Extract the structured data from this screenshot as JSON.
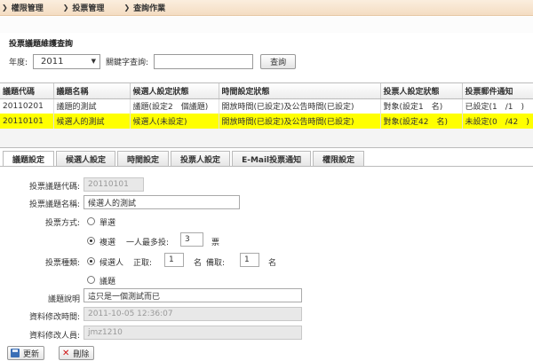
{
  "breadcrumb": [
    "權限管理",
    "投票管理",
    "查詢作業"
  ],
  "search": {
    "title": "投票議題維護查詢",
    "year_label": "年度:",
    "year_value": "2011",
    "keyword_label": "關鍵字查詢:",
    "keyword_value": "",
    "button": "查詢"
  },
  "table": {
    "headers": [
      "議題代碼",
      "議題名稱",
      "候選人設定狀態",
      "時間設定狀態",
      "投票人設定狀態",
      "投票郵件通知"
    ],
    "rows": [
      [
        "20110201",
        "議題的測試",
        "議題(設定2　個議題)",
        "開放時間(已設定)及公告時間(已設定)",
        "對象(設定1　名)",
        "已設定(1　/1　)"
      ],
      [
        "20110101",
        "候選人的測試",
        "候選人(未設定)",
        "開放時間(已設定)及公告時間(已設定)",
        "對象(設定42　名)",
        "未設定(0　/42　)"
      ]
    ]
  },
  "tabs": [
    "議題設定",
    "候選人設定",
    "時間設定",
    "投票人設定",
    "E-Mail投票通知",
    "權限設定"
  ],
  "form": {
    "code_label": "投票議題代碼:",
    "code_value": "20110101",
    "name_label": "投票議題名稱:",
    "name_value": "候選人的測試",
    "method_label": "投票方式:",
    "method_single": "單選",
    "method_multi": "複選",
    "max_label": "一人最多投:",
    "max_value": "3",
    "max_unit": "票",
    "type_label": "投票種類:",
    "type_candidate": "候選人",
    "main_label": "正取:",
    "main_value": "1",
    "unit1": "名",
    "backup_label": "備取:",
    "backup_value": "1",
    "unit2": "名",
    "type_issue": "議題",
    "desc_label": "議題說明",
    "desc_value": "這只是一個測試而已",
    "modtime_label": "資料修改時間:",
    "modtime_value": "2011-10-05 12:36:07",
    "modby_label": "資料修改人員:",
    "modby_value": "jmz1210"
  },
  "actions": {
    "update": "更新",
    "delete": "刪除"
  }
}
